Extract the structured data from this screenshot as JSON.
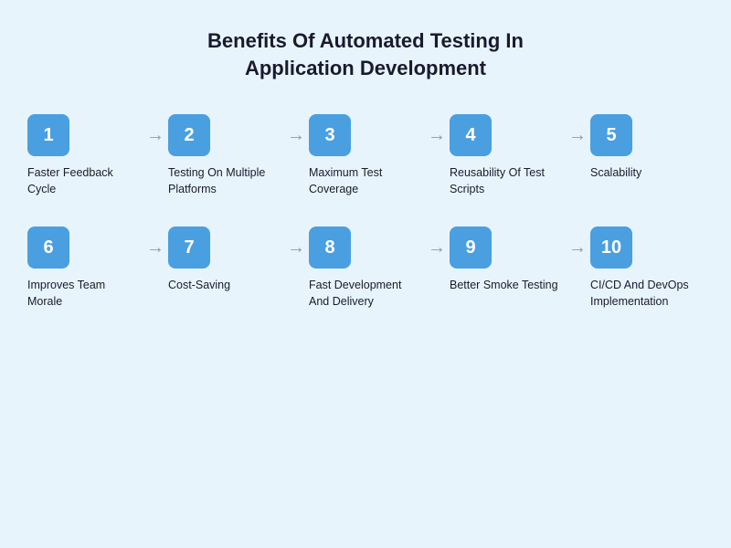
{
  "page": {
    "title": "Benefits Of Automated Testing In\nApplication Development",
    "background": "#e8f4fc",
    "accent_color": "#4a9fe0"
  },
  "rows": [
    {
      "steps": [
        {
          "number": "1",
          "label": "Faster Feedback Cycle"
        },
        {
          "number": "2",
          "label": "Testing On Multiple Platforms"
        },
        {
          "number": "3",
          "label": "Maximum Test Coverage"
        },
        {
          "number": "4",
          "label": "Reusability Of Test Scripts"
        },
        {
          "number": "5",
          "label": "Scalability"
        }
      ]
    },
    {
      "steps": [
        {
          "number": "6",
          "label": "Improves Team Morale"
        },
        {
          "number": "7",
          "label": "Cost-Saving"
        },
        {
          "number": "8",
          "label": "Fast Development And Delivery"
        },
        {
          "number": "9",
          "label": "Better Smoke Testing"
        },
        {
          "number": "10",
          "label": "CI/CD And DevOps Implementation"
        }
      ]
    }
  ]
}
